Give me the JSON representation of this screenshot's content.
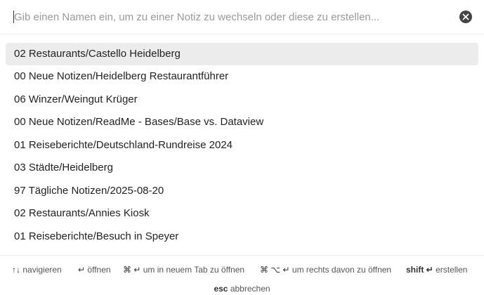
{
  "search": {
    "value": "",
    "placeholder": "Gib einen Namen ein, um zu einer Notiz zu wechseln oder diese zu erstellen..."
  },
  "clear_icon": "close-circle-icon",
  "results": [
    "02 Restaurants/Castello Heidelberg",
    "00 Neue Notizen/Heidelberg Restaurantführer",
    "06 Winzer/Weingut Krüger",
    "00 Neue Notizen/ReadMe - Bases/Base vs. Dataview",
    "01 Reiseberichte/Deutschland-Rundreise 2024",
    "03 Städte/Heidelberg",
    "97 Tägliche Notizen/2025-08-20",
    "02 Restaurants/Annies Kiosk",
    "01 Reiseberichte/Besuch in Speyer"
  ],
  "selected_index": 0,
  "footer": {
    "hints": [
      {
        "key": "↑↓",
        "text": "navigieren"
      },
      {
        "key": "↵",
        "text": "öffnen"
      },
      {
        "key": "⌘ ↵",
        "text": "um in neuem Tab zu öffnen"
      },
      {
        "key": "⌘ ⌥ ↵",
        "text": "um rechts davon zu öffnen"
      },
      {
        "key": "shift ↵",
        "text": "erstellen"
      }
    ],
    "escape": {
      "key": "esc",
      "text": "abbrechen"
    }
  },
  "colors": {
    "selected_bg": "#ececec",
    "placeholder": "#9a9a9a",
    "text": "#222222"
  }
}
